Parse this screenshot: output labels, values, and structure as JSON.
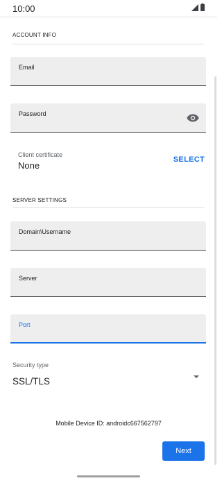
{
  "status_bar": {
    "time": "10:00",
    "icons": [
      "signal-icon",
      "battery-icon"
    ]
  },
  "account_info": {
    "header": "ACCOUNT INFO",
    "email": {
      "label": "Email",
      "value": ""
    },
    "password": {
      "label": "Password",
      "value": "",
      "toggle_icon": "eye-icon"
    },
    "client_certificate": {
      "label": "Client certificate",
      "value": "None",
      "action": "SELECT"
    }
  },
  "server_settings": {
    "header": "SERVER SETTINGS",
    "domain_username": {
      "label": "Domain\\Username",
      "value": ""
    },
    "server": {
      "label": "Server",
      "value": ""
    },
    "port": {
      "label": "Port",
      "value": "",
      "focused": true
    },
    "security_type": {
      "label": "Security type",
      "value": "SSL/TLS"
    }
  },
  "footer": {
    "device_id": "Mobile Device ID: androidc667562797",
    "next_label": "Next"
  },
  "colors": {
    "accent": "#1a73e8",
    "field_bg": "#eeeeee",
    "text": "#202124"
  }
}
